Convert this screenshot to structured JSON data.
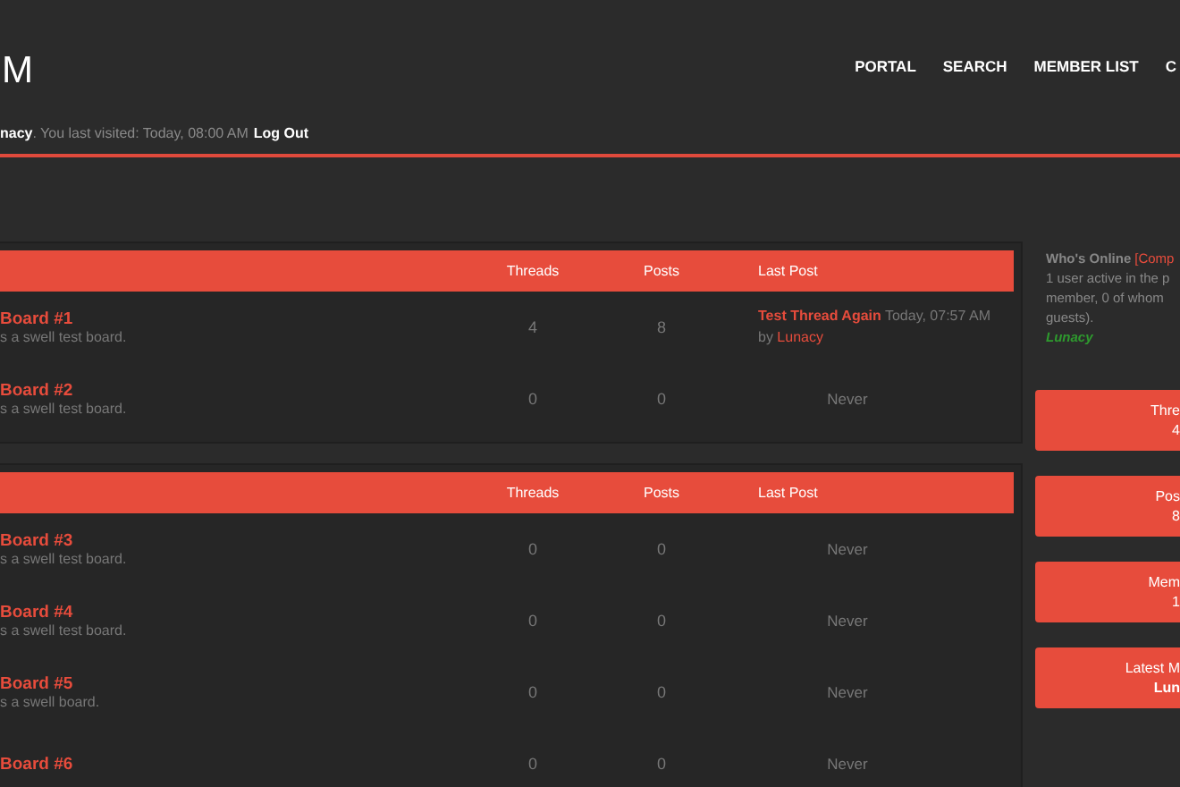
{
  "header": {
    "logo": "M",
    "nav": [
      {
        "label": "PORTAL"
      },
      {
        "label": "SEARCH"
      },
      {
        "label": "MEMBER LIST"
      },
      {
        "label": "C"
      }
    ],
    "welcome": {
      "user": "nacy",
      "text": ". You last visited: Today, 08:00 AM",
      "logout": "Log Out"
    }
  },
  "categories": [
    {
      "columns": [
        "Threads",
        "Posts",
        "Last Post"
      ],
      "forums": [
        {
          "title": "Board #1",
          "description": "s a swell test board.",
          "threads": "4",
          "posts": "8",
          "last_post": {
            "kind": "post",
            "thread": "Test Thread Again",
            "time": "Today, 07:57 AM",
            "by": "by",
            "user": "Lunacy"
          }
        },
        {
          "title": "Board #2",
          "description": "s a swell test board.",
          "threads": "0",
          "posts": "0",
          "last_post": {
            "kind": "never",
            "text": "Never"
          }
        }
      ]
    },
    {
      "columns": [
        "Threads",
        "Posts",
        "Last Post"
      ],
      "forums": [
        {
          "title": "Board #3",
          "description": "s a swell test board.",
          "threads": "0",
          "posts": "0",
          "last_post": {
            "kind": "never",
            "text": "Never"
          }
        },
        {
          "title": "Board #4",
          "description": "s a swell test board.",
          "threads": "0",
          "posts": "0",
          "last_post": {
            "kind": "never",
            "text": "Never"
          }
        },
        {
          "title": "Board #5",
          "description": "s a swell board.",
          "threads": "0",
          "posts": "0",
          "last_post": {
            "kind": "never",
            "text": "Never"
          }
        },
        {
          "title": "Board #6",
          "threads": "0",
          "posts": "0",
          "last_post": {
            "kind": "never",
            "text": "Never"
          }
        }
      ]
    }
  ],
  "sidebar": {
    "who_online": {
      "title": "Who's Online",
      "link": "[Comp",
      "lines": [
        "1 user active in the p",
        "member, 0 of whom",
        "guests)."
      ],
      "user": "Lunacy"
    },
    "stats": [
      {
        "label": "Thre",
        "value": "4"
      },
      {
        "label": "Pos",
        "value": "8"
      },
      {
        "label": "Mem",
        "value": "1"
      },
      {
        "label": "Latest M",
        "value": "Lun"
      }
    ]
  }
}
